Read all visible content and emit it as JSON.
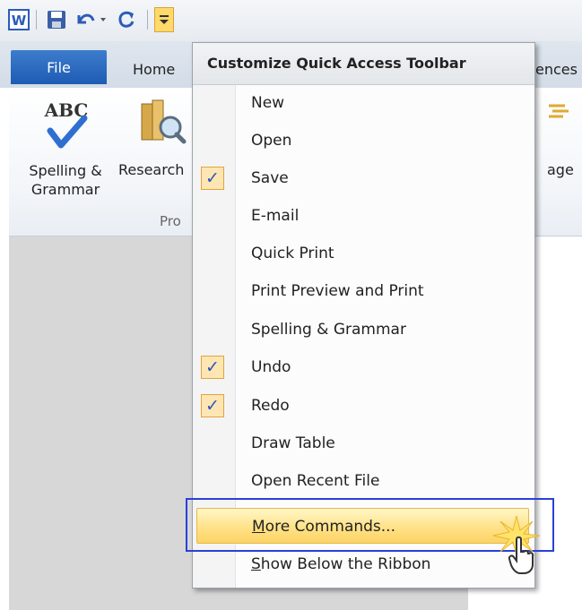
{
  "app": {
    "tabs": {
      "file": "File",
      "home": "Home",
      "references_partial": "ences"
    },
    "ribbon": {
      "spelling_label": "Spelling & Grammar",
      "research_label": "Research",
      "group_label_partial": "Pro",
      "page_label_partial": "age"
    },
    "icons": {
      "app_logo": "word-icon",
      "save": "save-icon",
      "undo": "undo-icon",
      "redo": "redo-icon",
      "customize": "customize-dropdown-icon",
      "spelling": "abc-check-icon",
      "research": "research-book-icon"
    }
  },
  "menu": {
    "title": "Customize Quick Access Toolbar",
    "items": [
      {
        "label": "New",
        "checked": false
      },
      {
        "label": "Open",
        "checked": false
      },
      {
        "label": "Save",
        "checked": true
      },
      {
        "label": "E-mail",
        "checked": false
      },
      {
        "label": "Quick Print",
        "checked": false
      },
      {
        "label": "Print Preview and Print",
        "checked": false
      },
      {
        "label": "Spelling & Grammar",
        "checked": false
      },
      {
        "label": "Undo",
        "checked": true
      },
      {
        "label": "Redo",
        "checked": true
      },
      {
        "label": "Draw Table",
        "checked": false
      },
      {
        "label": "Open Recent File",
        "checked": false
      },
      {
        "label_accel": "M",
        "label_rest": "ore Commands...",
        "checked": false
      },
      {
        "label_accel": "S",
        "label_rest": "how Below the Ribbon",
        "checked": false
      }
    ],
    "check_glyph": "✓"
  },
  "colors": {
    "file_tab": "#1d5cb3",
    "hover_fill": "#ffe083",
    "highlight_box": "#2b3fd8",
    "check_fill": "#fde6b3"
  }
}
